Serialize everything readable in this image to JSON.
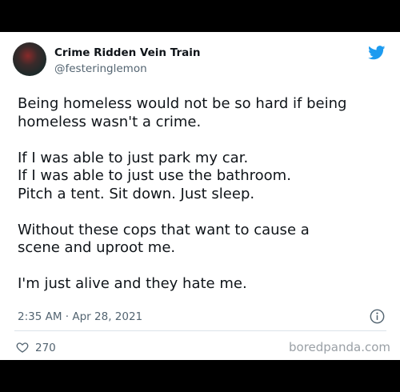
{
  "user": {
    "display_name": "Crime Ridden Vein Train",
    "handle": "@festeringlemon"
  },
  "tweet": {
    "paragraphs": [
      [
        "Being homeless would not be so hard if being",
        "homeless wasn't a crime."
      ],
      [
        "If I was able to just park my car.",
        "If I was able to just use the bathroom.",
        "Pitch a tent. Sit down. Just sleep."
      ],
      [
        "Without these cops that want to cause a",
        "scene and uproot me."
      ],
      [
        "I'm just alive and they hate me."
      ]
    ],
    "timestamp": "2:35 AM · Apr 28, 2021",
    "likes": "270"
  },
  "watermark": "boredpanda.com",
  "icons": {
    "brand": "twitter-bird-icon",
    "info": "info-icon",
    "like": "heart-icon"
  },
  "colors": {
    "twitter_blue": "#1d9bf0",
    "text_primary": "#0f1419",
    "text_secondary": "#536471"
  }
}
